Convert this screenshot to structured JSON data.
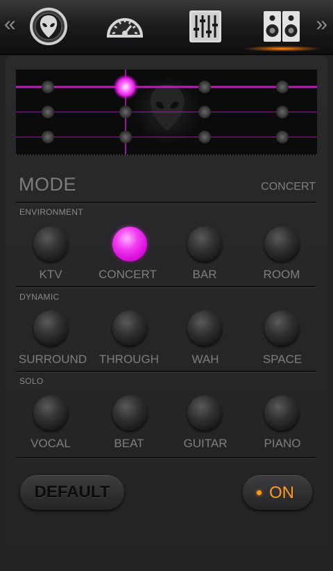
{
  "colors": {
    "accent": "#ff9a1e",
    "active_knob": "#e020e0",
    "visual_line": "#d21ed2"
  },
  "topbar": {
    "left_arrow": "«",
    "right_arrow": "»",
    "tabs": [
      {
        "icon": "alien-icon"
      },
      {
        "icon": "speedometer-icon"
      },
      {
        "icon": "equalizer-icon"
      },
      {
        "icon": "speaker-icon",
        "selected": true
      }
    ]
  },
  "mode": {
    "label": "MODE",
    "value": "CONCERT"
  },
  "sections": [
    {
      "title": "ENVIRONMENT",
      "options": [
        {
          "label": "KTV",
          "active": false
        },
        {
          "label": "CONCERT",
          "active": true
        },
        {
          "label": "BAR",
          "active": false
        },
        {
          "label": "ROOM",
          "active": false
        }
      ]
    },
    {
      "title": "DYNAMIC",
      "options": [
        {
          "label": "SURROUND",
          "active": false
        },
        {
          "label": "THROUGH",
          "active": false
        },
        {
          "label": "WAH",
          "active": false
        },
        {
          "label": "SPACE",
          "active": false
        }
      ]
    },
    {
      "title": "SOLO",
      "options": [
        {
          "label": "VOCAL",
          "active": false
        },
        {
          "label": "BEAT",
          "active": false
        },
        {
          "label": "GUITAR",
          "active": false
        },
        {
          "label": "PIANO",
          "active": false
        }
      ]
    }
  ],
  "buttons": {
    "default_label": "DEFAULT",
    "power_label": "ON"
  }
}
